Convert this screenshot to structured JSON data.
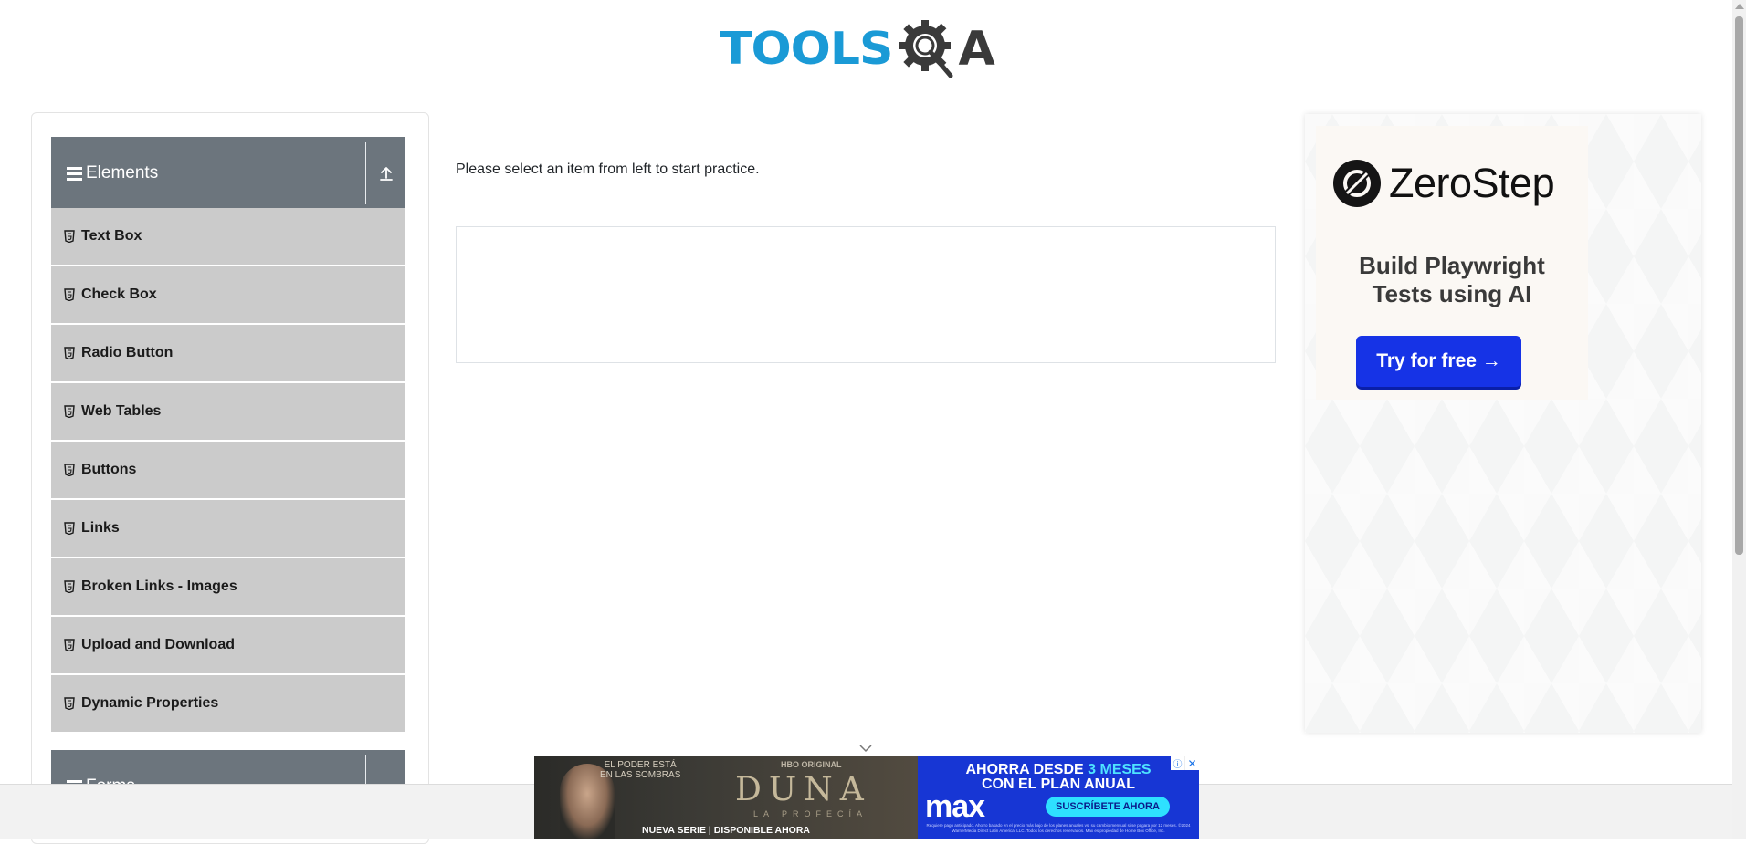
{
  "header": {
    "logo_text_primary": "TOOLS",
    "logo_text_secondary": "A",
    "logo_icon": "magnifier-gear-icon",
    "brand_blue": "#1a9ad6"
  },
  "sidebar": {
    "group": {
      "title": "Elements",
      "expand_icon": "upload-arrow-icon"
    },
    "items": [
      {
        "label": "Text Box"
      },
      {
        "label": "Check Box"
      },
      {
        "label": "Radio Button"
      },
      {
        "label": "Web Tables"
      },
      {
        "label": "Buttons"
      },
      {
        "label": "Links"
      },
      {
        "label": "Broken Links - Images"
      },
      {
        "label": "Upload and Download"
      },
      {
        "label": "Dynamic Properties"
      }
    ],
    "next_group": {
      "title": "Forms"
    },
    "header_color": "#6c757d",
    "item_color": "#cbcbcb"
  },
  "main": {
    "instruction": "Please select an item from left to start practice."
  },
  "side_ad": {
    "brand": "ZeroStep",
    "headline": "Build Playwright\nTests using AI",
    "button_label": "Try for free →",
    "button_color": "#1633e6"
  },
  "bottom_ad": {
    "tagline": "EL PODER ESTÁ\nEN LAS SOMBRAS",
    "network": "HBO ORIGINAL",
    "title": "DUNA",
    "subtitle": "LA PROFECÍA",
    "footer": "NUEVA SERIE | DISPONIBLE AHORA",
    "offer_line1_prefix": "AHORRA DESDE ",
    "offer_line1_highlight": "3 MESES",
    "offer_line2": "CON EL PLAN ANUAL",
    "brand": "max",
    "cta": "SUSCRÍBETE AHORA",
    "fine_print": "Requiere pago anticipado. Ahorro basado en el precio más bajo de los planes anuales vs. su cambio mensual si se pagara por 12 meses. ©2024 WarnerMedia Direct Latin America, LLC. Todos los derechos reservados. Max es propiedad de Home Box Office, Inc.",
    "info_icon": "info-icon",
    "close_icon": "close-icon"
  }
}
